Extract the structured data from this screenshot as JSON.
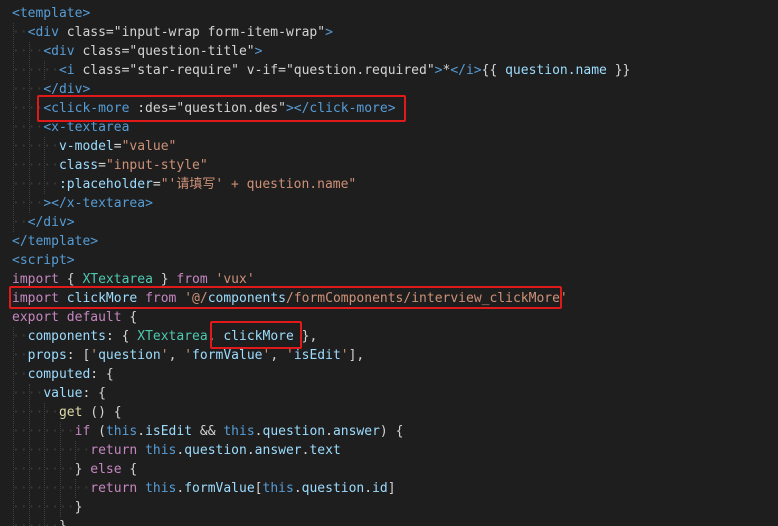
{
  "editor": {
    "lines": [
      "<template>",
      "<div class=\"input-wrap form-item-wrap\">",
      "<div class=\"question-title\">",
      "<i class=\"star-require\" v-if=\"question.required\">*</i>{{ question.name }}",
      "</div>",
      "<click-more :des=\"question.des\"></click-more>",
      "<x-textarea",
      "v-model=\"value\"",
      "class=\"input-style\"",
      ":placeholder=\"'请填写' + question.name\"",
      "></x-textarea>",
      "</div>",
      "</template>",
      "<script>",
      "import { XTextarea } from 'vux'",
      "import clickMore from '@/components/formComponents/interview_clickMore'",
      "export default {",
      "components: { XTextarea, clickMore },",
      "props: ['question', 'formValue', 'isEdit'],",
      "computed: {",
      "value: {",
      "get () {",
      "if (this.isEdit && this.question.answer) {",
      "return this.question.answer.text",
      "} else {",
      "return this.formValue[this.question.id]",
      "}",
      "}"
    ]
  },
  "colors": {
    "background": "#1e1e1e",
    "tag": "#569cd6",
    "attribute": "#9cdcfe",
    "string": "#ce9178",
    "keyword": "#c586c0",
    "class_name": "#4ec9b0",
    "function": "#dcdcaa",
    "highlight_box": "#e0191b"
  }
}
